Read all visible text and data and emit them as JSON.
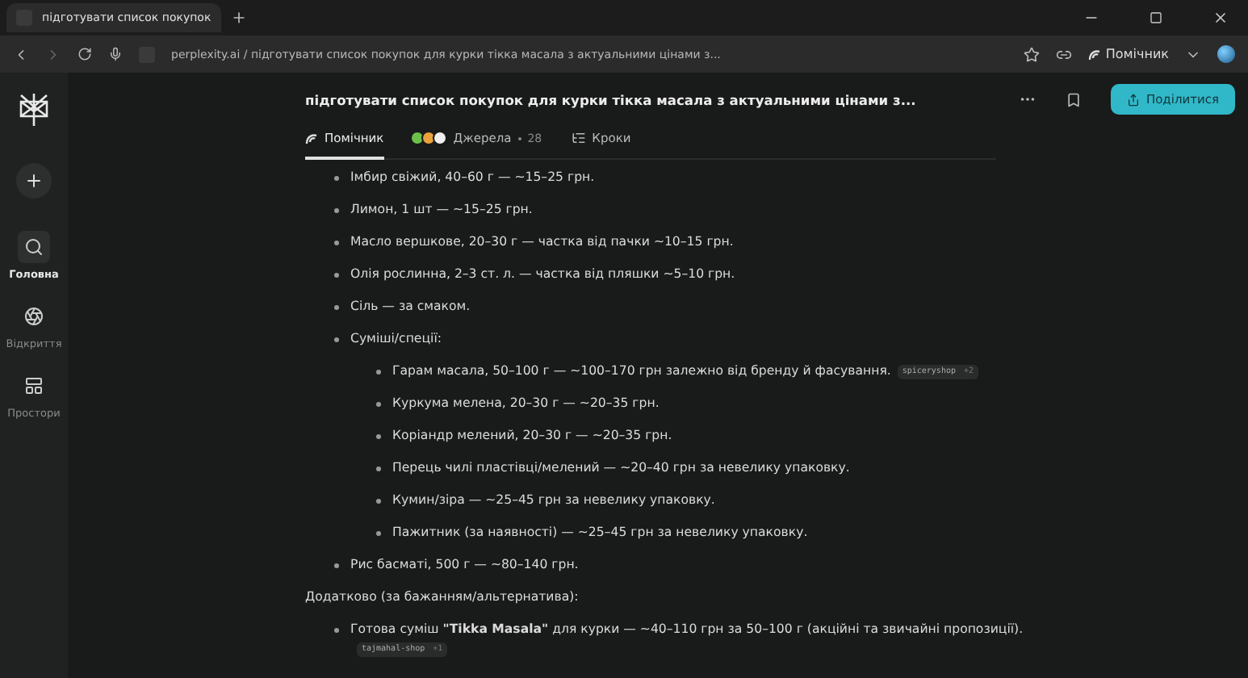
{
  "browser": {
    "tabs": [
      {
        "title": "підготувати список покупок",
        "selected": true
      }
    ],
    "address": "perplexity.ai / підготувати список покупок для курки тікка масала з актуальними цінами з...",
    "assistant_button": "Помічник"
  },
  "sidebar": {
    "items": [
      {
        "label": "Головна",
        "selected": true
      },
      {
        "label": "Відкриття",
        "selected": false
      },
      {
        "label": "Простори",
        "selected": false
      }
    ]
  },
  "thread": {
    "title": "підготувати список покупок для курки тікка масала з актуальними цінами з...",
    "share_button": "Поділитися",
    "tabs": [
      {
        "label": "Помічник",
        "selected": true
      },
      {
        "label": "Джерела",
        "count": "28",
        "selected": false
      },
      {
        "label": "Кроки",
        "selected": false
      }
    ]
  },
  "answer": [
    {
      "kind": "list",
      "items": [
        {
          "text": "Імбир свіжий, 40–60 г — ~15–25 грн."
        },
        {
          "text": "Лимон, 1 шт — ~15–25 грн."
        },
        {
          "text": "Масло вершкове, 20–30 г — частка від пачки ~10–15 грн."
        },
        {
          "text": "Олія рослинна, 2–3 ст. л. — частка від пляшки ~5–10 грн."
        },
        {
          "text": "Сіль — за смаком."
        },
        {
          "text": "Суміші/спеції:",
          "children": [
            {
              "text": "Гарам масала, 50–100 г — ~100–170 грн залежно від бренду й фасування.",
              "source": "spiceryshop",
              "more": "+2"
            },
            {
              "text": "Куркума мелена, 20–30 г — ~20–35 грн."
            },
            {
              "text": "Коріандр мелений, 20–30 г — ~20–35 грн."
            },
            {
              "text": "Перець чилі пластівці/мелений — ~20–40 грн за невелику упаковку."
            },
            {
              "text": "Кумин/зіра — ~25–45 грн за невелику упаковку."
            },
            {
              "text": "Пажитник (за наявності) — ~25–45 грн за невелику упаковку."
            }
          ]
        },
        {
          "text": "Рис басматі, 500 г — ~80–140 грн."
        }
      ]
    },
    {
      "kind": "paragraph",
      "text": "Додатково (за бажанням/альтернатива):"
    },
    {
      "kind": "list",
      "items": [
        {
          "text": "Готова суміш **\"Tikka Masala\"** для курки — ~40–110 грн за 50–100 г (акційні та звичайні пропозиції).",
          "source": "tajmahal-shop",
          "more": "+1"
        }
      ]
    }
  ]
}
